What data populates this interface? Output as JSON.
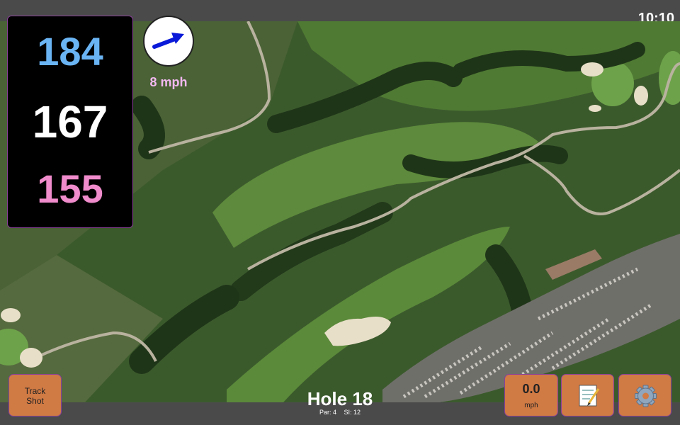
{
  "status": {
    "time": "10:10"
  },
  "yardages": {
    "back": "184",
    "middle": "167",
    "front": "155"
  },
  "wind": {
    "speed_text": "8 mph"
  },
  "buttons": {
    "track_line1": "Track",
    "track_line2": "Shot",
    "speed_value": "0.0",
    "speed_unit": "mph"
  },
  "hole": {
    "title": "Hole 18",
    "par": "Par: 4",
    "si": "SI: 12"
  },
  "colors": {
    "back": "#6ab4f4",
    "middle": "#ffffff",
    "front": "#f08ccc",
    "button": "#d07a44",
    "border": "#8a3f9a"
  },
  "icons": {
    "wind": "wind-arrow-icon",
    "notes": "notepad-icon",
    "settings": "gear-icon"
  }
}
